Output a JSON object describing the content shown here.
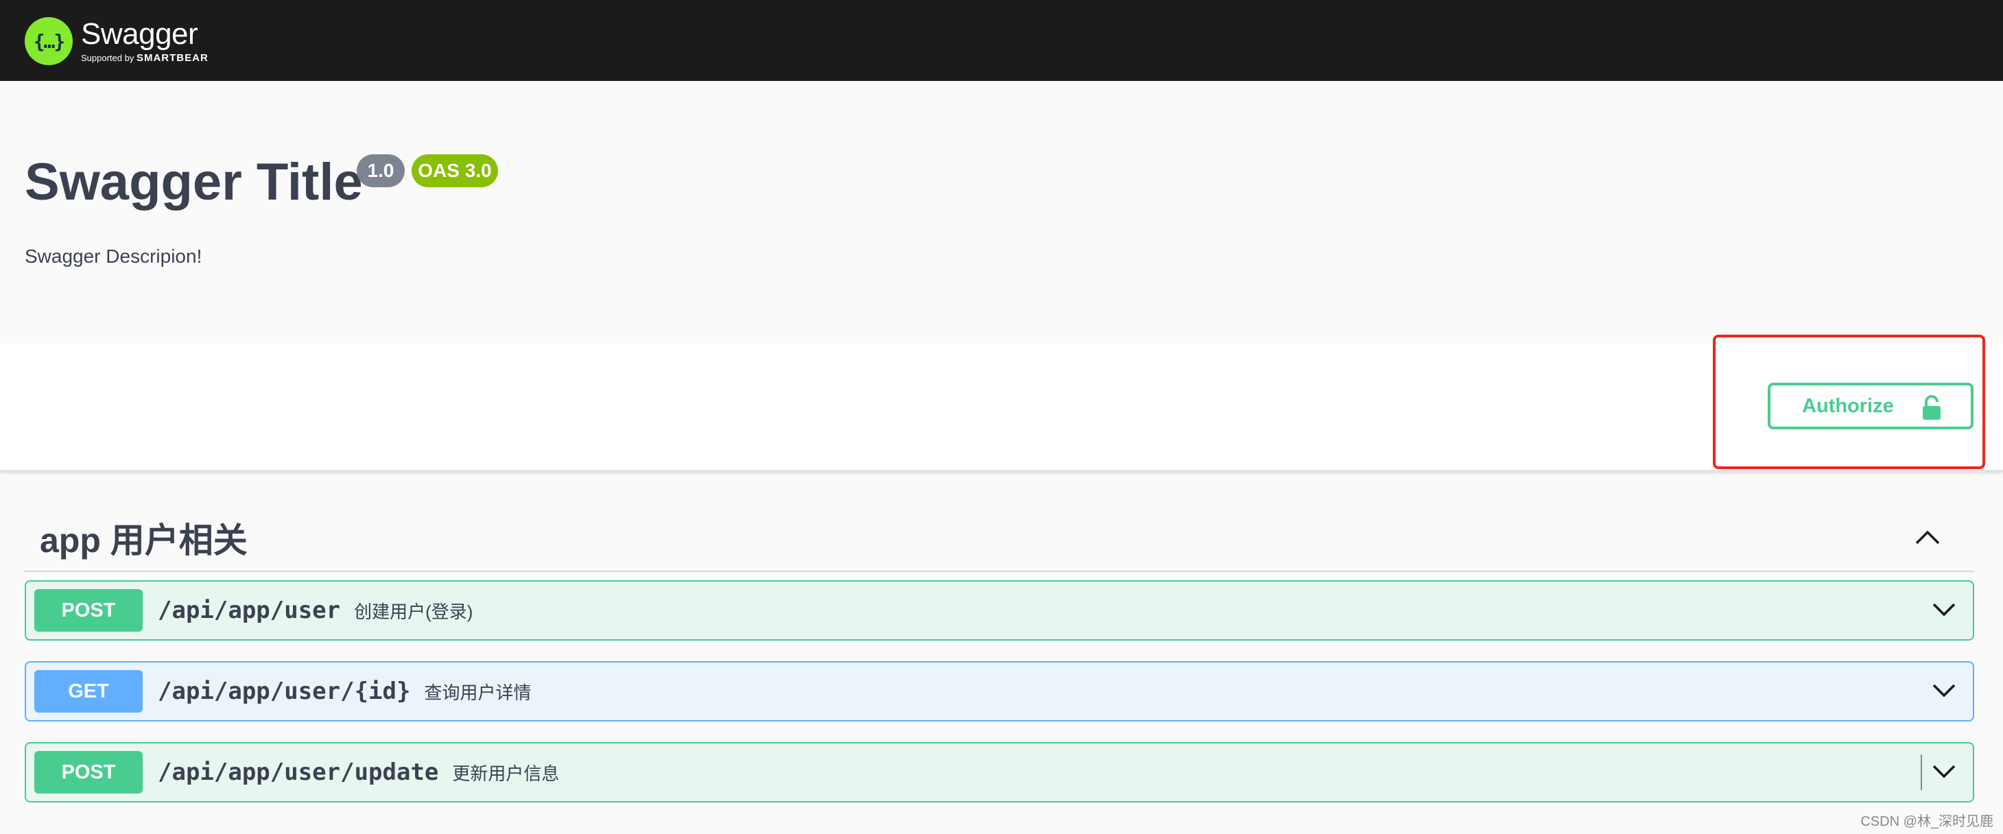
{
  "topbar": {
    "logo_glyph": "{…}",
    "logo_name": "Swagger",
    "logo_sub_prefix": "Supported by",
    "logo_sub_brand": "SMARTBEAR",
    "logo_color": "#85ea2d"
  },
  "info": {
    "title": "Swagger Title",
    "version": "1.0",
    "oas": "OAS 3.0",
    "description": "Swagger Descripion!"
  },
  "authorize": {
    "label": "Authorize",
    "icon": "unlock-icon",
    "color": "#49cc90"
  },
  "tag": {
    "name": "app 用户相关",
    "expanded": true
  },
  "operations": [
    {
      "method": "POST",
      "path": "/api/app/user",
      "summary": "创建用户(登录)"
    },
    {
      "method": "GET",
      "path": "/api/app/user/{id}",
      "summary": "查询用户详情"
    },
    {
      "method": "POST",
      "path": "/api/app/user/update",
      "summary": "更新用户信息"
    }
  ],
  "colors": {
    "post": "#49cc90",
    "get": "#61affe",
    "highlight": "#e8281b"
  },
  "watermark": "CSDN @林_深时见鹿"
}
